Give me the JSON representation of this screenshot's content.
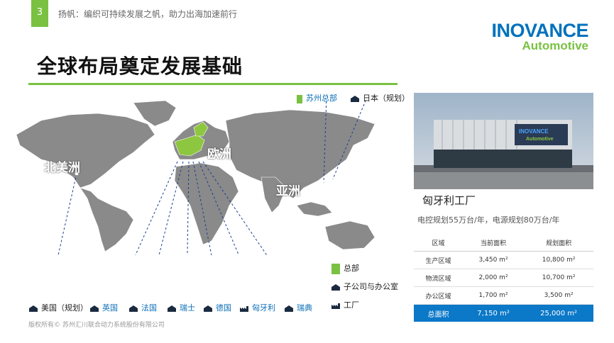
{
  "slide": {
    "number": "3",
    "topline": "扬帆：编织可持续发展之帆，助力出海加速前行",
    "title": "全球布局奠定发展基础",
    "footer": "版权所有© 苏州汇川联合动力系统股份有限公司"
  },
  "logo": {
    "line1": "INOVANCE",
    "line2": "Automotive",
    "brand_blue": "#0072bc",
    "brand_green": "#7ac142"
  },
  "map": {
    "regions": {
      "north_america": "北美洲",
      "europe": "欧洲",
      "asia": "亚洲"
    },
    "top_labels": {
      "hq": "苏州总部",
      "japan": "日本（规划）"
    },
    "bottom_labels": {
      "usa": "美国（规划）",
      "uk": "英国",
      "france": "法国",
      "switzerland": "瑞士",
      "germany": "德国",
      "hungary": "匈牙利",
      "sweden": "瑞典"
    }
  },
  "legend": {
    "hq": "总部",
    "subsidiary": "子公司与办公室",
    "factory": "工厂"
  },
  "photo": {
    "sign_line1": "INOVANCE",
    "sign_line2": "Automotive"
  },
  "factory": {
    "name": "匈牙利工厂",
    "desc": "电控规划55万台/年，电源规划80万台/年",
    "table": {
      "headers": [
        "区域",
        "当前面积",
        "规划面积"
      ],
      "rows": [
        [
          "生产区域",
          "3,450 m²",
          "10,800 m²"
        ],
        [
          "物流区域",
          "2,000 m²",
          "10,700 m²"
        ],
        [
          "办公区域",
          "1,700 m²",
          "3,500 m²"
        ]
      ],
      "total": [
        "总面积",
        "7,150 m²",
        "25,000 m²"
      ]
    }
  }
}
